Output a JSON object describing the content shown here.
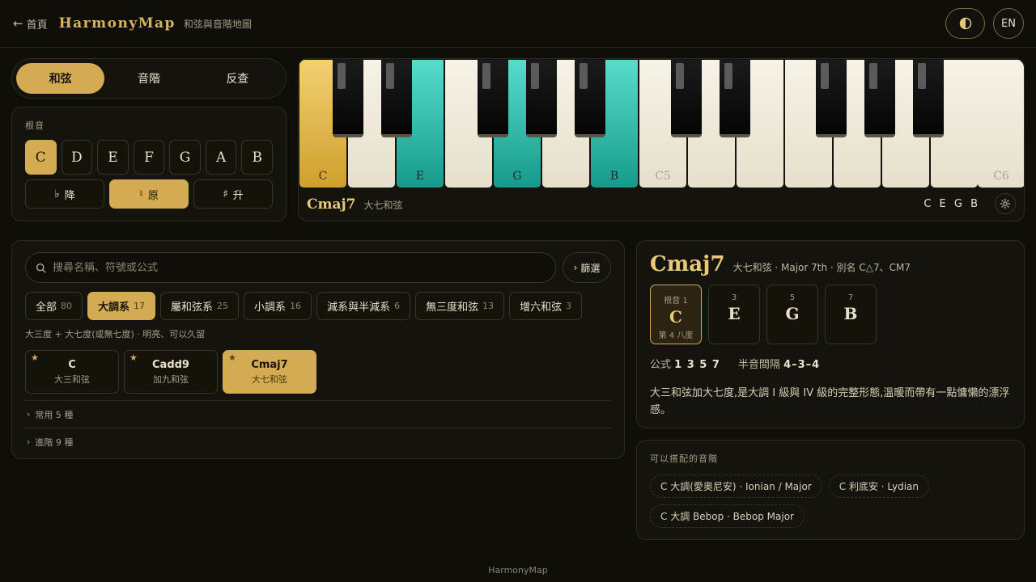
{
  "header": {
    "back_label": "首頁",
    "brand": "HarmonyMap",
    "subtitle": "和弦與音階地圖",
    "theme_icon": "half-circle-icon",
    "lang_label": "EN"
  },
  "mode_tabs": [
    "和弦",
    "音階",
    "反查"
  ],
  "root": {
    "label": "根音",
    "notes": [
      "C",
      "D",
      "E",
      "F",
      "G",
      "A",
      "B"
    ],
    "selected": "C",
    "accidentals": [
      {
        "symbol": "♭",
        "label": "降"
      },
      {
        "symbol": "♮",
        "label": "原"
      },
      {
        "symbol": "♯",
        "label": "升"
      }
    ]
  },
  "piano": {
    "white_labels": [
      "C",
      "",
      "E",
      "",
      "G",
      "",
      "B",
      "C5",
      "",
      "",
      "",
      "",
      "",
      "",
      "C6"
    ],
    "chord_name": "Cmaj7",
    "chord_desc": "大七和弦",
    "notes_text": "C E G B",
    "accent_root": "#d3ab52",
    "accent_tone": "#1fb3a2"
  },
  "search": {
    "placeholder": "搜尋名稱、符號或公式",
    "filter_label": "篩選"
  },
  "categories": [
    {
      "label": "全部",
      "count": "80"
    },
    {
      "label": "大調系",
      "count": "17"
    },
    {
      "label": "屬和弦系",
      "count": "25"
    },
    {
      "label": "小調系",
      "count": "16"
    },
    {
      "label": "減系與半減系",
      "count": "6"
    },
    {
      "label": "無三度和弦",
      "count": "13"
    },
    {
      "label": "增六和弦",
      "count": "3"
    }
  ],
  "category_hint": "大三度 + 大七度(或無七度) · 明亮、可以久留",
  "chords": [
    {
      "name": "C",
      "desc": "大三和弦"
    },
    {
      "name": "Cadd9",
      "desc": "加九和弦"
    },
    {
      "name": "Cmaj7",
      "desc": "大七和弦"
    }
  ],
  "collapse": [
    "常用 5 種",
    "進階 9 種"
  ],
  "detail": {
    "name": "Cmaj7",
    "meta": "大七和弦 · Major 7th · 別名 C△7、CM7",
    "tones": [
      {
        "degree": "根音 1",
        "note": "C",
        "octave": "第 4 八度"
      },
      {
        "degree": "3",
        "note": "E",
        "octave": ""
      },
      {
        "degree": "5",
        "note": "G",
        "octave": ""
      },
      {
        "degree": "7",
        "note": "B",
        "octave": ""
      }
    ],
    "formula_label": "公式",
    "formula": "1 3 5 7",
    "interval_label": "半音間隔",
    "interval": "4–3–4",
    "description": "大三和弦加大七度,是大調 I 級與 IV 級的完整形態,溫暖而帶有一點慵懶的漂浮感。"
  },
  "scales": {
    "label": "可以搭配的音階",
    "items": [
      "C 大調(愛奧尼安) · Ionian / Major",
      "C 利底安 · Lydian",
      "C 大調 Bebop · Bebop Major"
    ]
  },
  "footer": "HarmonyMap"
}
